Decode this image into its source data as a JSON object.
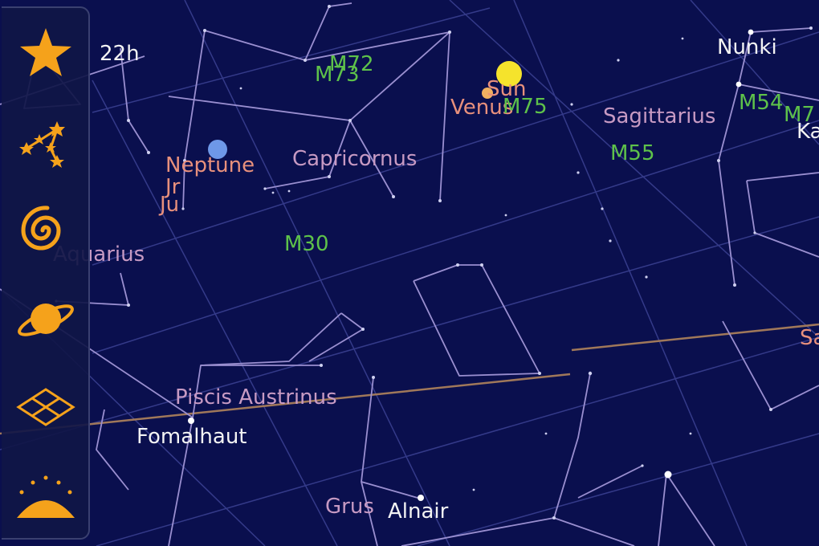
{
  "app": "Sky Map",
  "colors": {
    "background": "#0a0f4e",
    "constellation_line": "#9a8fd0",
    "grid_line": "#3c4294",
    "ecliptic": "#a0785a",
    "icon_orange": "#f5a21b",
    "constellation_label": "#c79ac3",
    "planet_label": "#e8907c",
    "messier_label": "#5ec24a",
    "star_label": "#f3f3f3"
  },
  "toolbar": {
    "items": [
      {
        "name": "stars-layer-button",
        "icon": "star-icon"
      },
      {
        "name": "constellations-layer-button",
        "icon": "constellation-icon"
      },
      {
        "name": "messier-layer-button",
        "icon": "galaxy-icon"
      },
      {
        "name": "planets-layer-button",
        "icon": "planet-icon"
      },
      {
        "name": "grid-layer-button",
        "icon": "grid-icon"
      },
      {
        "name": "horizon-layer-button",
        "icon": "horizon-icon"
      }
    ]
  },
  "sky": {
    "ra_label": "22h",
    "constellations": {
      "capricornus": "Capricornus",
      "aquarius": "Aquarius",
      "sagittarius": "Sagittarius",
      "piscis_austrinus": "Piscis Austrinus",
      "grus": "Grus"
    },
    "planets": {
      "sun": "Sun",
      "venus": "Venus",
      "neptune": "Neptune",
      "uranus": "Jr",
      "jupiter": "Ju",
      "saturn": "Sa"
    },
    "messier": {
      "m72": "M72",
      "m73": "M73",
      "m75": "M75",
      "m30": "M30",
      "m55": "M55",
      "m54": "M54",
      "m70": "M7"
    },
    "stars": {
      "nunki": "Nunki",
      "fomalhaut": "Fomalhaut",
      "alnair": "Alnair",
      "kaus": "Ka"
    }
  }
}
